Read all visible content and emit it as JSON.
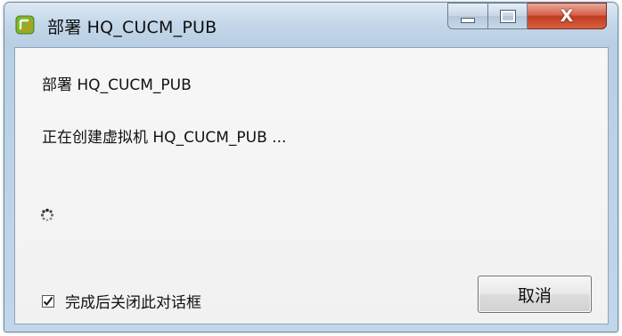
{
  "window": {
    "title": "部署 HQ_CUCM_PUB",
    "app_icon": "vsphere-app-icon",
    "controls": {
      "minimize": "minimize-icon",
      "maximize": "maximize-icon",
      "close": "close-icon",
      "close_glyph": "X"
    }
  },
  "dialog": {
    "heading": "部署 HQ_CUCM_PUB",
    "status": "正在创建虚拟机 HQ_CUCM_PUB ...",
    "progress_icon": "busy-spinner-icon",
    "close_on_complete": {
      "label": "完成后关闭此对话框",
      "checked": true
    },
    "cancel_label": "取消"
  },
  "colors": {
    "close_button": "#c13c21",
    "titlebar": "#c5d8ea",
    "client_bg": "#f3f3f3",
    "icon_green": "#7fb52b",
    "icon_orange": "#e08a1e"
  }
}
